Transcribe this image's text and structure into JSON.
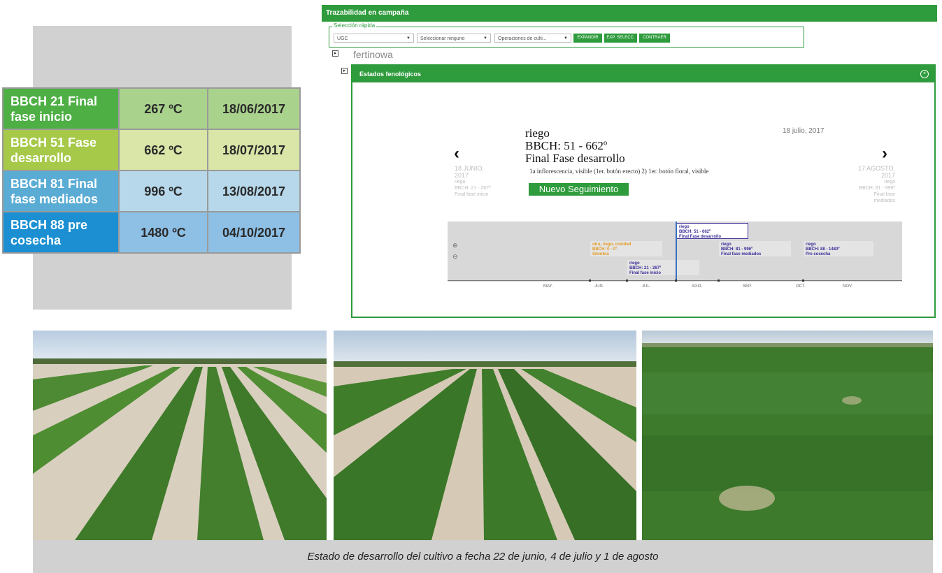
{
  "table": {
    "rows": [
      {
        "label": "BBCH 21 Final fase inicio",
        "gdd": "267 ºC",
        "date": "18/06/2017",
        "label_bg": "#4daf44",
        "cell_bg": "#a9d28c"
      },
      {
        "label": "BBCH 51 Fase desarrollo",
        "gdd": "662 ºC",
        "date": "18/07/2017",
        "label_bg": "#a6c94a",
        "cell_bg": "#d9e6a8"
      },
      {
        "label": "BBCH 81 Final fase mediados",
        "gdd": "996 ºC",
        "date": "13/08/2017",
        "label_bg": "#5aacd4",
        "cell_bg": "#b6d8ea"
      },
      {
        "label": "BBCH 88 pre cosecha",
        "gdd": "1480 ºC",
        "date": "04/10/2017",
        "label_bg": "#1b8fd2",
        "cell_bg": "#8ec0e6"
      }
    ]
  },
  "app": {
    "header_title": "Trazabilidad en campaña",
    "quick_select_label": "Selección rápida",
    "selects": [
      "UGC",
      "Seleccionar ninguno",
      "Operaciones de culti..."
    ],
    "buttons": [
      "EXPANDIR",
      "EXP. SELECC.",
      "CONTRAER"
    ],
    "tree_root": "fertinowa"
  },
  "modal": {
    "title": "Estados fenológicos",
    "detail": {
      "line1": "riego",
      "line2": "BBCH: 51 - 662º",
      "line3": "Final Fase desarrollo",
      "description": "1a inflorescencia, visible (1er. botón erecto) 2) 1er. botón floral, visible",
      "date": "18 julio, 2017",
      "new_button": "Nuevo Seguimiento"
    },
    "prev": {
      "date_1": "18 JUNIO,",
      "date_2": "2017",
      "l1": "riego",
      "l2": "BBCH: 21 - 267º",
      "l3": "Final fase inicio"
    },
    "next": {
      "date_1": "17 AGOSTO,",
      "date_2": "2017",
      "l1": "riego",
      "l2": "BBCH: 81 - 996º",
      "l3": "Final fase",
      "l4": "mediados"
    },
    "timeline": {
      "items": [
        {
          "l1": "riego",
          "l2": "BBCH: 21 - 267º",
          "l3": "Final fase inicio"
        },
        {
          "l1": "otra, riego, cosidad",
          "l2": "BBCH: 0 - 0º",
          "l3": "Siembra"
        },
        {
          "l1": "riego",
          "l2": "BBCH: 51 - 662º",
          "l3": "Final Fase desarrollo"
        },
        {
          "l1": "riego",
          "l2": "BBCH: 81 - 996º",
          "l3": "Final fase mediados"
        },
        {
          "l1": "riego",
          "l2": "BBCH: 88 - 1480º",
          "l3": "Pre cosecha"
        }
      ],
      "months": [
        "MAY.",
        "JUN.",
        "JUL.",
        "AGO.",
        "SEP.",
        "OCT.",
        "NOV."
      ],
      "zoom_in": "⊕",
      "zoom_out": "⊖"
    }
  },
  "caption": "Estado de desarrollo del cultivo a fecha 22 de junio, 4 de julio y 1 de agosto",
  "colors": {
    "accent_green": "#2e9b3c",
    "timeline_blue": "#3a2f99",
    "timeline_orange": "#e39a1e"
  }
}
